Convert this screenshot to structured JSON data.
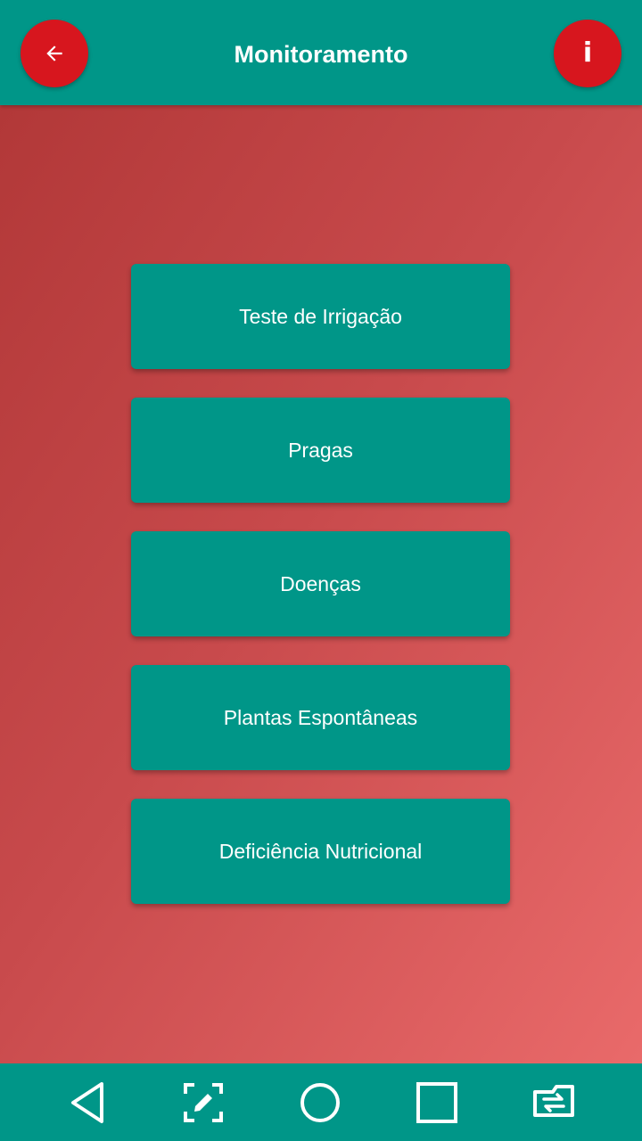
{
  "header": {
    "title": "Monitoramento",
    "back_icon": "arrow-left-icon",
    "info_label": "i",
    "background": "#009688",
    "button_color": "#d7161e"
  },
  "menu": {
    "items": [
      {
        "label": "Teste de Irrigação"
      },
      {
        "label": "Pragas"
      },
      {
        "label": "Doenças"
      },
      {
        "label": "Plantas Espontâneas"
      },
      {
        "label": "Deficiência Nutricional"
      }
    ],
    "button_color": "#009688"
  },
  "background_gradient": [
    "#b23838",
    "#e96a6a"
  ],
  "system_nav": {
    "icons": [
      "back-triangle-icon",
      "screenshot-edit-icon",
      "home-circle-icon",
      "recents-square-icon",
      "switch-apps-icon"
    ]
  }
}
